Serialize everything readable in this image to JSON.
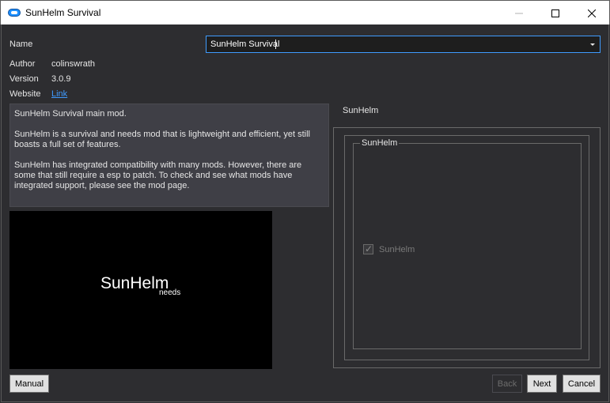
{
  "window": {
    "title": "SunHelm Survival"
  },
  "form": {
    "name_label": "Name",
    "name_value": "SunHelm Survival",
    "author_label": "Author",
    "author_value": "colinswrath",
    "version_label": "Version",
    "version_value": "3.0.9",
    "website_label": "Website",
    "website_link": "Link"
  },
  "description": {
    "paragraphs": [
      "SunHelm Survival main mod.",
      "SunHelm is a survival and needs mod that is lightweight and efficient, yet still boasts a full set of features.",
      "SunHelm has integrated compatibility with many mods. However, there are some that still require a esp to patch. To check and see what mods have integrated support, please see the mod page."
    ]
  },
  "preview": {
    "logo_main": "SunHelm",
    "logo_sub": "needs"
  },
  "options": {
    "outer_group_title": "SunHelm",
    "inner_group_title": "SunHelm",
    "checkbox_label": "SunHelm",
    "checkbox_checked": true
  },
  "buttons": {
    "manual": "Manual",
    "back": "Back",
    "next": "Next",
    "cancel": "Cancel"
  },
  "colors": {
    "background": "#2d2d30",
    "accent": "#3f9bff",
    "description_bg": "#3f3f46"
  }
}
